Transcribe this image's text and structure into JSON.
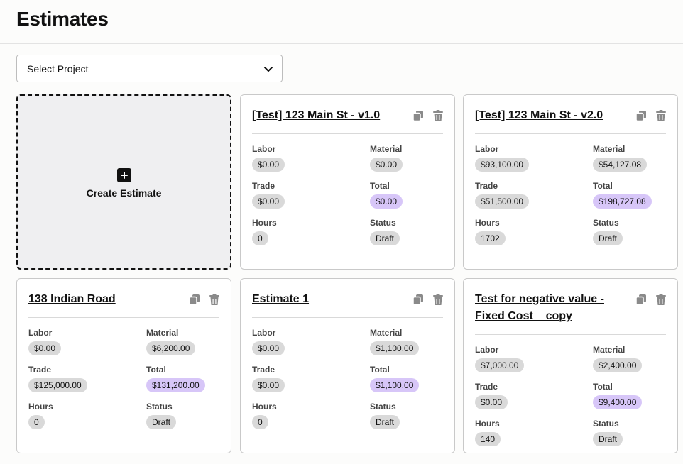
{
  "page": {
    "title": "Estimates"
  },
  "project_select": {
    "value": "Select Project"
  },
  "create_card": {
    "label": "Create Estimate"
  },
  "labels": {
    "labor": "Labor",
    "material": "Material",
    "trade": "Trade",
    "total": "Total",
    "hours": "Hours",
    "status": "Status"
  },
  "cards": [
    {
      "title": "[Test] 123 Main St - v1.0",
      "labor": "$0.00",
      "material": "$0.00",
      "trade": "$0.00",
      "total": "$0.00",
      "hours": "0",
      "status": "Draft"
    },
    {
      "title": "[Test] 123 Main St - v2.0",
      "labor": "$93,100.00",
      "material": "$54,127.08",
      "trade": "$51,500.00",
      "total": "$198,727.08",
      "hours": "1702",
      "status": "Draft"
    },
    {
      "title": "138 Indian Road",
      "labor": "$0.00",
      "material": "$6,200.00",
      "trade": "$125,000.00",
      "total": "$131,200.00",
      "hours": "0",
      "status": "Draft"
    },
    {
      "title": "Estimate 1",
      "labor": "$0.00",
      "material": "$1,100.00",
      "trade": "$0.00",
      "total": "$1,100.00",
      "hours": "0",
      "status": "Draft"
    },
    {
      "title": "Test for negative value - Fixed Cost__copy",
      "labor": "$7,000.00",
      "material": "$2,400.00",
      "trade": "$0.00",
      "total": "$9,400.00",
      "hours": "140",
      "status": "Draft"
    }
  ]
}
